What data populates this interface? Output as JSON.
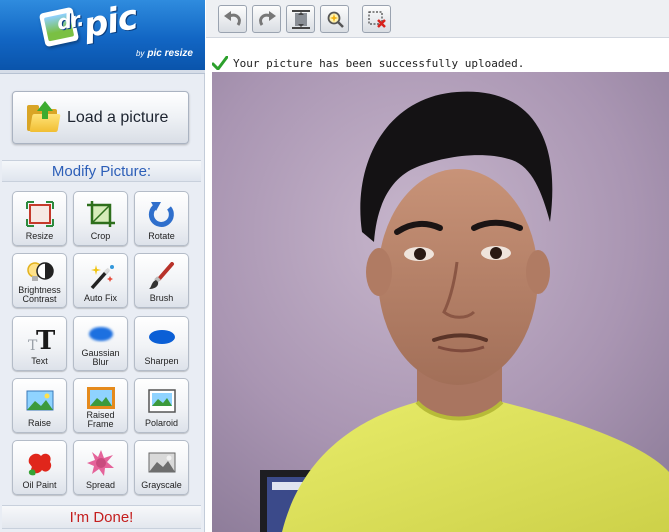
{
  "logo": {
    "brand": "dr.pic",
    "brand_prefix": "dr.",
    "brand_main": "pic",
    "tagline_by": "by",
    "tagline_name": "pic resize"
  },
  "sidebar": {
    "load_label": "Load a picture",
    "modify_header": "Modify Picture:",
    "done_label": "I'm Done!",
    "tools": [
      {
        "label": "Resize",
        "icon": "resize-icon"
      },
      {
        "label": "Crop",
        "icon": "crop-icon"
      },
      {
        "label": "Rotate",
        "icon": "rotate-icon"
      },
      {
        "label_line1": "Brightness",
        "label_line2": "Contrast",
        "icon": "brightness-contrast-icon"
      },
      {
        "label": "Auto Fix",
        "icon": "magic-wand-icon"
      },
      {
        "label": "Brush",
        "icon": "brush-icon"
      },
      {
        "label": "Text",
        "icon": "text-icon"
      },
      {
        "label_line1": "Gaussian",
        "label_line2": "Blur",
        "icon": "gaussian-blur-icon"
      },
      {
        "label": "Sharpen",
        "icon": "sharpen-icon"
      },
      {
        "label": "Raise",
        "icon": "raise-icon"
      },
      {
        "label_line1": "Raised",
        "label_line2": "Frame",
        "icon": "raised-frame-icon"
      },
      {
        "label": "Polaroid",
        "icon": "polaroid-icon"
      },
      {
        "label": "Oil Paint",
        "icon": "oil-paint-icon"
      },
      {
        "label": "Spread",
        "icon": "spread-icon"
      },
      {
        "label": "Grayscale",
        "icon": "grayscale-icon"
      }
    ]
  },
  "toolbar": {
    "buttons": [
      {
        "name": "undo",
        "icon": "undo-icon"
      },
      {
        "name": "redo",
        "icon": "redo-icon"
      },
      {
        "name": "fit",
        "icon": "fit-screen-icon"
      },
      {
        "name": "zoom",
        "icon": "zoom-magic-icon"
      },
      {
        "name": "deselect",
        "icon": "deselect-icon"
      }
    ]
  },
  "status": {
    "message": "Your picture has been successfully uploaded.",
    "icon": "checkmark-icon"
  },
  "colors": {
    "logo_blue": "#1266c4",
    "modify_header_text": "#2d5fb8",
    "done_text": "#c41e1e",
    "check_green": "#2ca02c"
  }
}
